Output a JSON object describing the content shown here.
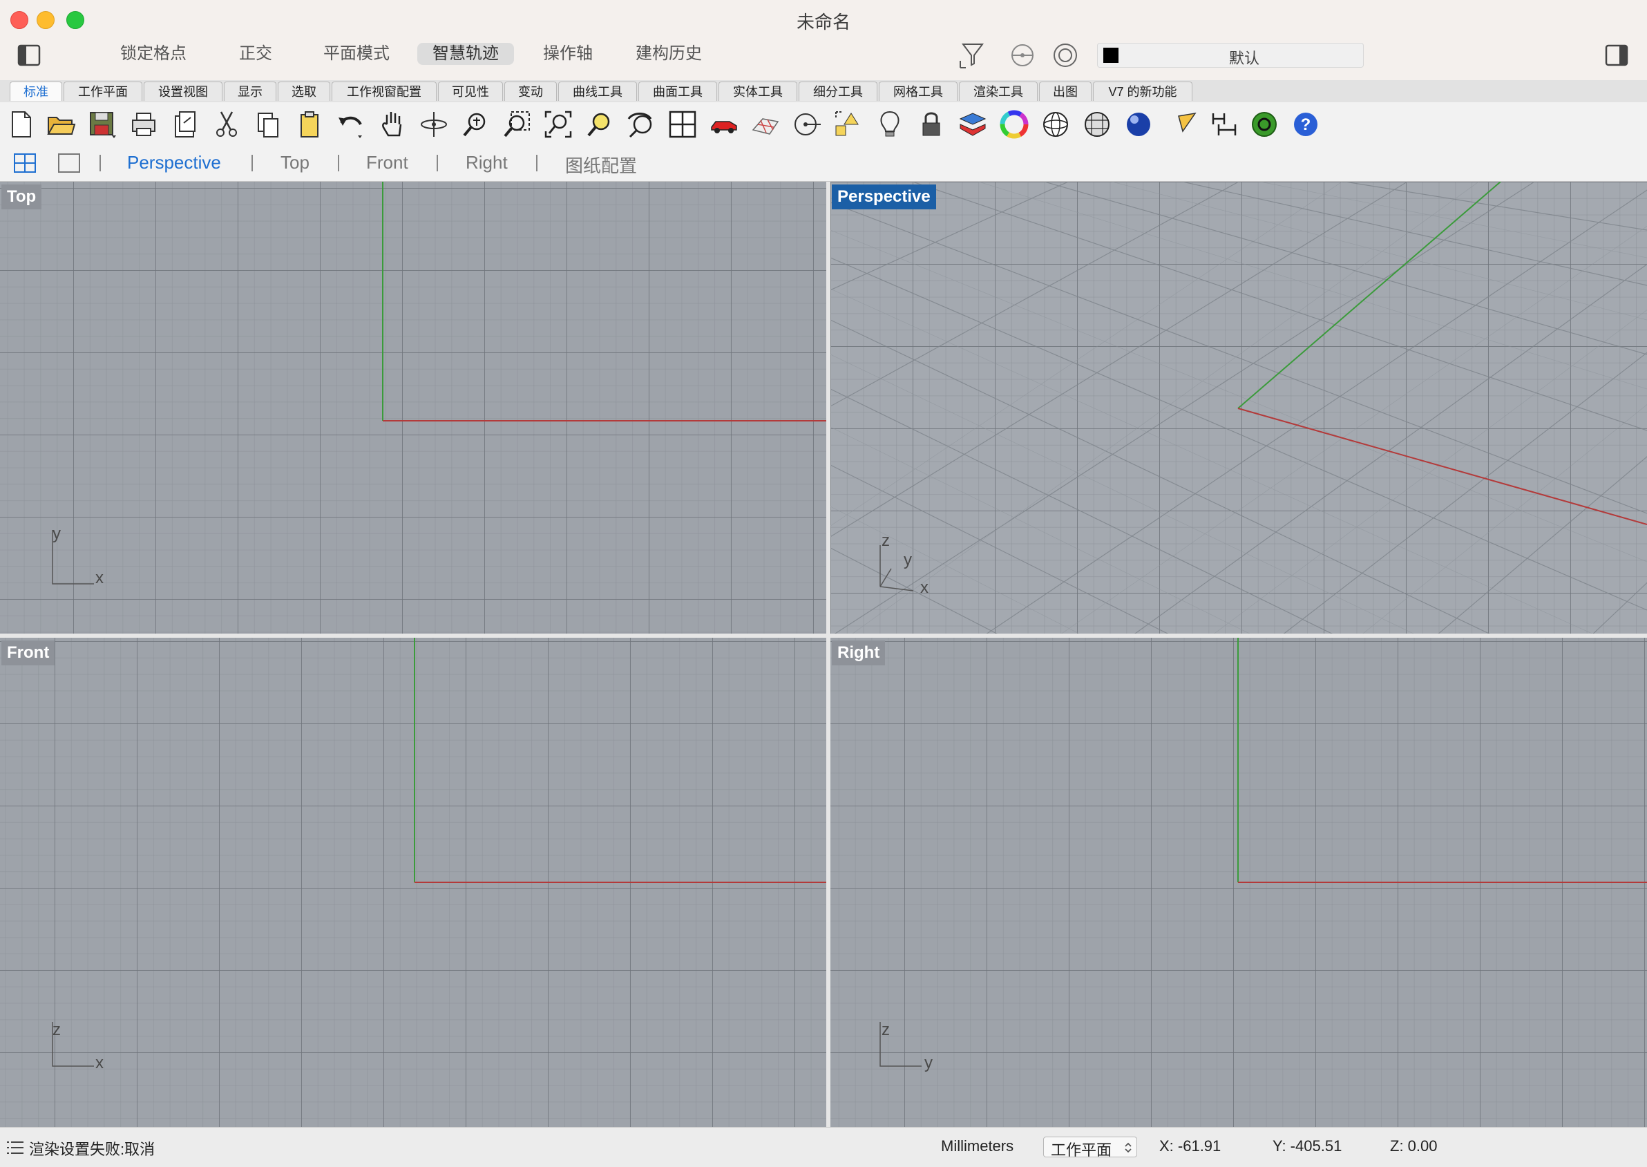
{
  "window": {
    "title": "未命名"
  },
  "modes": [
    {
      "label": "锁定格点",
      "active": false
    },
    {
      "label": "正交",
      "active": false
    },
    {
      "label": "平面模式",
      "active": false
    },
    {
      "label": "智慧轨迹",
      "active": true
    },
    {
      "label": "操作轴",
      "active": false
    },
    {
      "label": "建构历史",
      "active": false
    }
  ],
  "layer": {
    "name": "默认",
    "color": "#000000"
  },
  "tabs": [
    "标准",
    "工作平面",
    "设置视图",
    "显示",
    "选取",
    "工作视窗配置",
    "可见性",
    "变动",
    "曲线工具",
    "曲面工具",
    "实体工具",
    "细分工具",
    "网格工具",
    "渲染工具",
    "出图",
    "V7 的新功能"
  ],
  "active_tab": "标准",
  "toolbar_icons": [
    "new-file-icon",
    "open-file-icon",
    "save-icon",
    "print-icon",
    "import-icon",
    "cut-icon",
    "copy-icon",
    "paste-icon",
    "undo-icon",
    "pan-hand-icon",
    "rotate-view-icon",
    "zoom-icon",
    "zoom-window-icon",
    "zoom-extents-icon",
    "zoom-selected-icon",
    "undo-view-icon",
    "four-viewports-icon",
    "car-icon",
    "grid-snap-icon",
    "point-osnap-icon",
    "shapes-icon",
    "light-icon",
    "lock-icon",
    "layer-icon",
    "color-wheel-icon",
    "wireframe-sphere-icon",
    "mesh-sphere-icon",
    "render-sphere-icon",
    "pen-icon",
    "dimension-icon",
    "green-render-icon",
    "help-icon"
  ],
  "viewport_tabs": {
    "items": [
      "Perspective",
      "Top",
      "Front",
      "Right",
      "图纸配置"
    ],
    "active": "Perspective"
  },
  "viewports": {
    "top": {
      "label": "Top",
      "axes": [
        "y",
        "x"
      ]
    },
    "perspective": {
      "label": "Perspective",
      "axes": [
        "z",
        "y",
        "x"
      ]
    },
    "front": {
      "label": "Front",
      "axes": [
        "z",
        "x"
      ]
    },
    "right": {
      "label": "Right",
      "axes": [
        "z",
        "y"
      ]
    }
  },
  "status": {
    "message": "渲染设置失败:取消",
    "units": "Millimeters",
    "cplane": "工作平面",
    "x": "X: -61.91",
    "y": "Y: -405.51",
    "z": "Z: 0.00"
  },
  "colors": {
    "accent": "#1e6fd1",
    "x_axis": "#b33a3a",
    "y_axis": "#3b9b3b",
    "viewport_bg": "#9ea3aa",
    "active_label": "#1b5fa6"
  }
}
